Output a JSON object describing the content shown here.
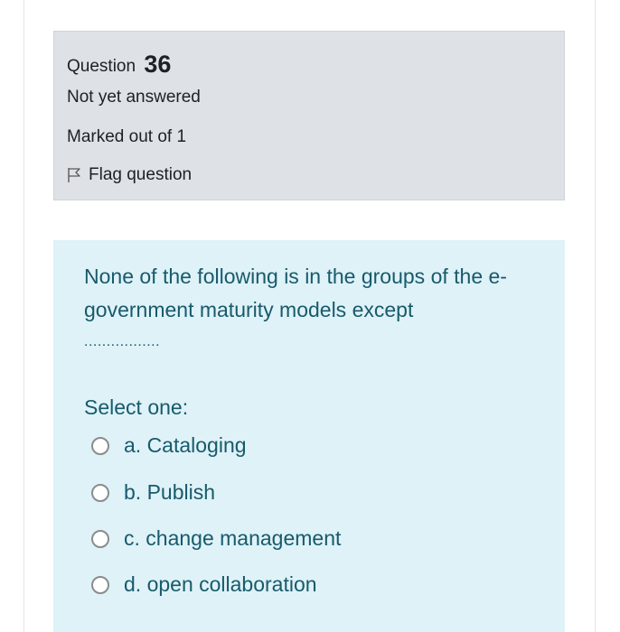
{
  "question_info": {
    "label": "Question",
    "number": "36",
    "state": "Not yet answered",
    "grade": "Marked out of 1",
    "flag_label": "Flag question"
  },
  "question": {
    "text": "None of the following is in the groups of the e-government maturity models except",
    "blank": ".................",
    "prompt": "Select one:",
    "options": [
      {
        "label": "a. Cataloging"
      },
      {
        "label": "b. Publish"
      },
      {
        "label": "c. change management"
      },
      {
        "label": "d. open collaboration"
      }
    ]
  },
  "colors": {
    "info_background": "#dee2e6",
    "content_background": "#def2f8",
    "question_text": "#185a6b"
  }
}
